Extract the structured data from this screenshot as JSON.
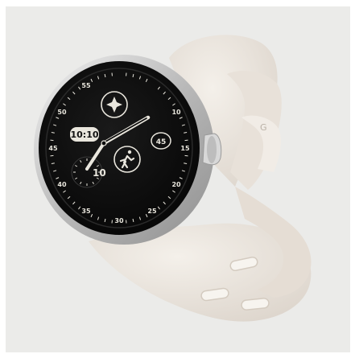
{
  "product": {
    "strap_color": "#ece6df",
    "case_color": "#c9c9c9",
    "screen_color": "#0b0b0b",
    "accent_text_color": "#e9e6dd"
  },
  "watch_face": {
    "time": "10:10",
    "subdial_value": "10",
    "badge_value": "45",
    "bezel_numbers": [
      "55",
      "10",
      "15",
      "20",
      "25",
      "30",
      "35",
      "40",
      "45",
      "50"
    ],
    "complications": [
      "sparkle-icon",
      "running-icon"
    ]
  }
}
